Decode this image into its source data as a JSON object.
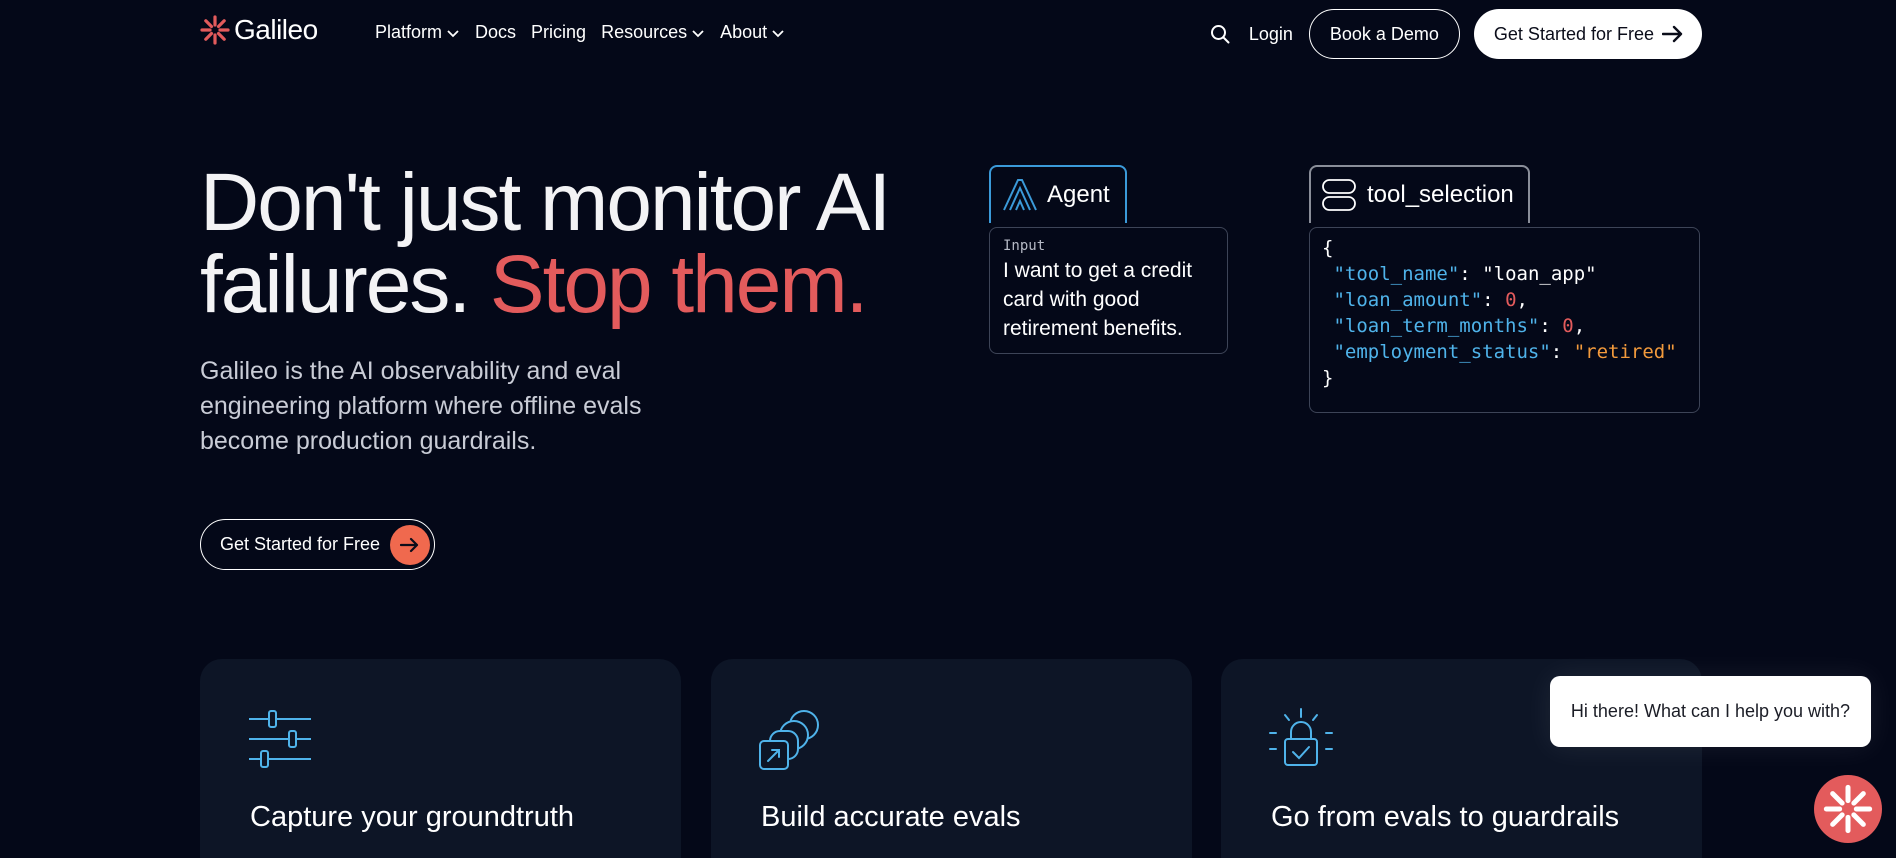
{
  "brand": {
    "name": "Galileo",
    "accent": "#e35b5c"
  },
  "nav": {
    "links": [
      {
        "label": "Platform",
        "dropdown": true
      },
      {
        "label": "Docs",
        "dropdown": false
      },
      {
        "label": "Pricing",
        "dropdown": false
      },
      {
        "label": "Resources",
        "dropdown": true
      },
      {
        "label": "About",
        "dropdown": true
      }
    ],
    "login": "Login",
    "demo": "Book a Demo",
    "start": "Get Started for Free"
  },
  "hero": {
    "title_line1": "Don't just monitor AI",
    "title_line2_plain": "failures. ",
    "title_line2_accent": "Stop them.",
    "subtitle": "Galileo is the AI observability and eval engineering platform where offline evals become production guardrails.",
    "cta": "Get Started for Free"
  },
  "agent_card": {
    "tab_label": "Agent",
    "input_label": "Input",
    "input_text": "I want to get a credit card with good retirement benefits."
  },
  "tool_card": {
    "tab_label": "tool_selection",
    "open_brace": "{",
    "close_brace": "}",
    "fields": [
      {
        "key": "\"tool_name\"",
        "value": "\"loan_app\"",
        "value_type": "string-plain",
        "comma": ""
      },
      {
        "key": "\"loan_amount\"",
        "value": "0",
        "value_type": "number",
        "comma": ","
      },
      {
        "key": "\"loan_term_months\"",
        "value": "0",
        "value_type": "number",
        "comma": ","
      },
      {
        "key": "\"employment_status\"",
        "value": "\"retired\"",
        "value_type": "string",
        "comma": ""
      }
    ]
  },
  "features": [
    {
      "title": "Capture your groundtruth",
      "icon": "sliders-icon"
    },
    {
      "title": "Build accurate evals",
      "icon": "stacked-cards-icon"
    },
    {
      "title": "Go from evals to guardrails",
      "icon": "lock-icon"
    }
  ],
  "chat": {
    "greeting": "Hi there! What can I help you with?"
  }
}
